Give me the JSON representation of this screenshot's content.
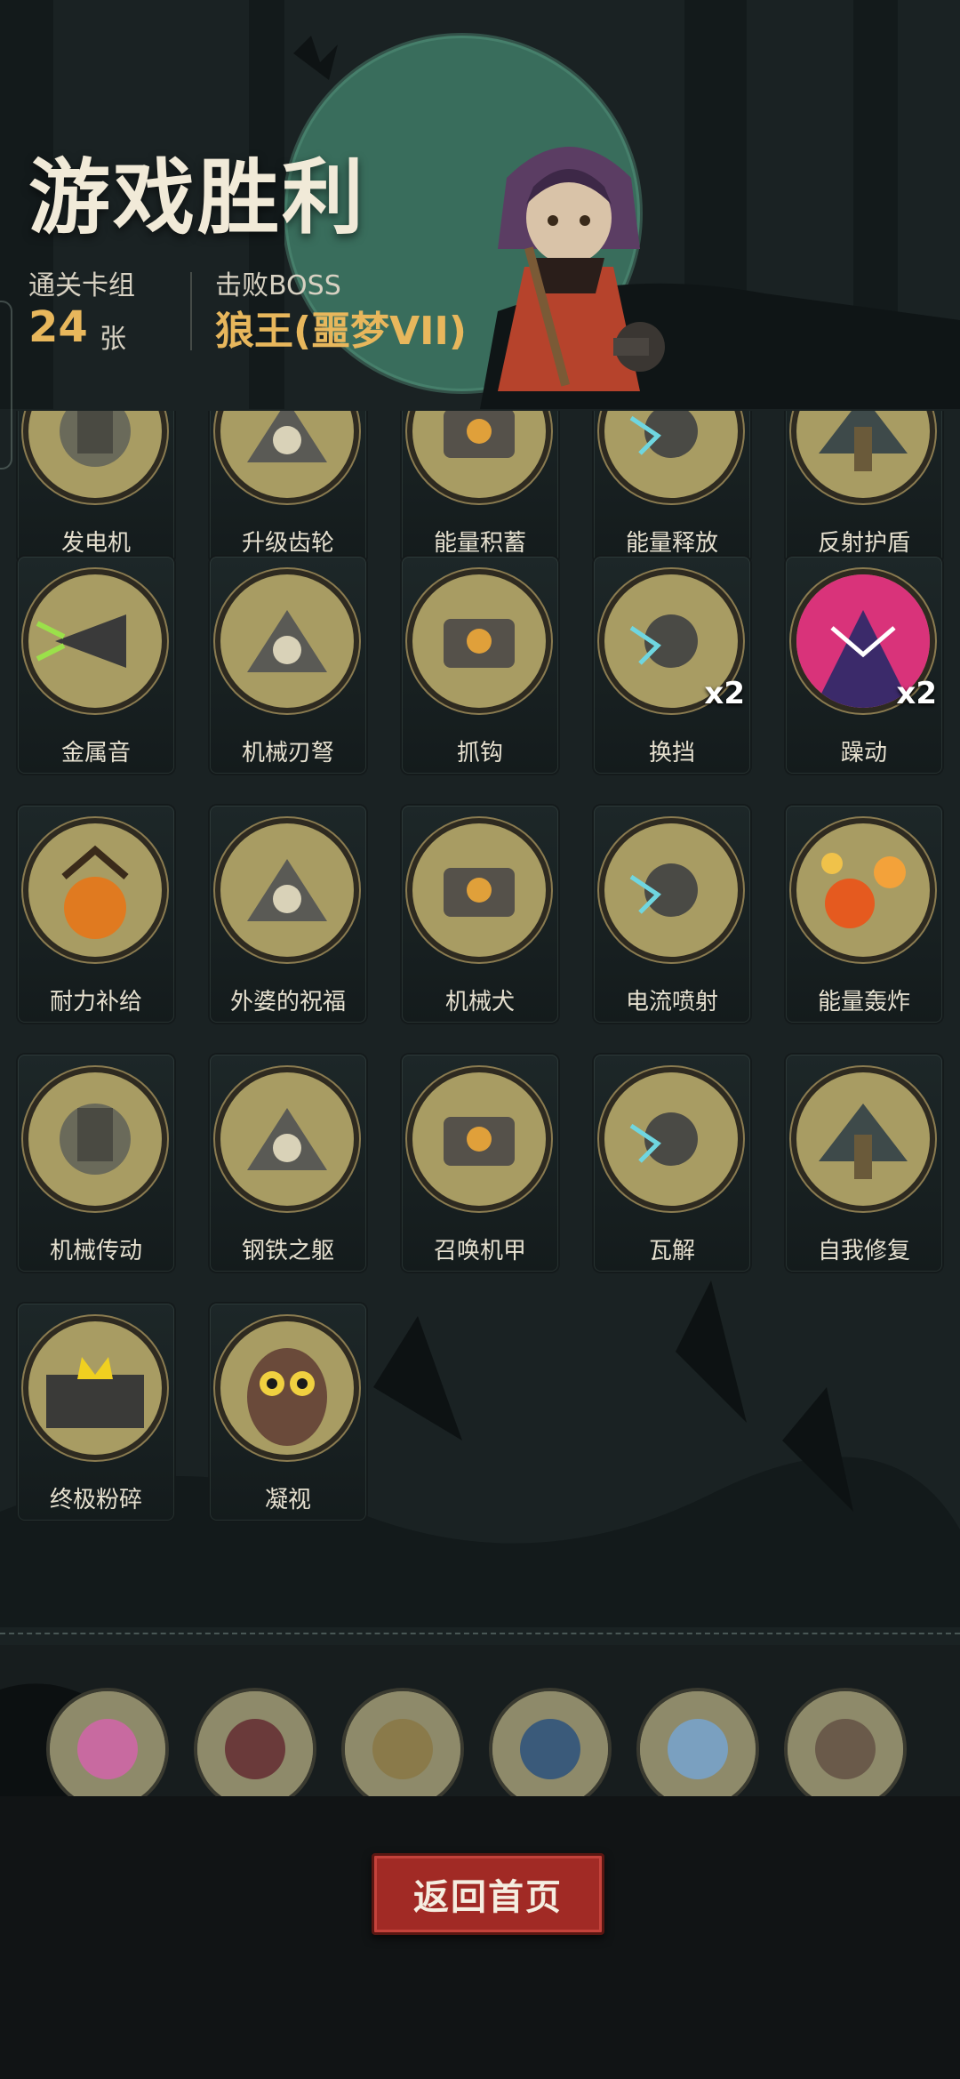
{
  "header": {
    "title": "游戏胜利",
    "deck_label": "通关卡组",
    "deck_count": "24",
    "deck_unit": "张",
    "boss_label": "击败BOSS",
    "boss_name": "狼王(噩梦VII)"
  },
  "cards": [
    {
      "name": "发电机",
      "icon": "generator-icon"
    },
    {
      "name": "升级齿轮",
      "icon": "upgrade-gear-icon"
    },
    {
      "name": "能量积蓄",
      "icon": "energy-charge-icon"
    },
    {
      "name": "能量释放",
      "icon": "energy-release-icon"
    },
    {
      "name": "反射护盾",
      "icon": "reflect-shield-icon"
    },
    {
      "name": "金属音",
      "icon": "metal-horn-icon"
    },
    {
      "name": "机械刃弩",
      "icon": "mech-blade-crossbow-icon"
    },
    {
      "name": "抓钩",
      "icon": "grappling-hook-icon"
    },
    {
      "name": "换挡",
      "icon": "gear-shift-icon",
      "mult": "x2"
    },
    {
      "name": "躁动",
      "icon": "restless-icon",
      "mult": "x2"
    },
    {
      "name": "耐力补给",
      "icon": "stamina-supply-icon"
    },
    {
      "name": "外婆的祝福",
      "icon": "grandma-blessing-icon"
    },
    {
      "name": "机械犬",
      "icon": "mech-dog-icon"
    },
    {
      "name": "电流喷射",
      "icon": "current-jet-icon"
    },
    {
      "name": "能量轰炸",
      "icon": "energy-bombard-icon"
    },
    {
      "name": "机械传动",
      "icon": "mech-transmission-icon"
    },
    {
      "name": "钢铁之躯",
      "icon": "steel-body-icon"
    },
    {
      "name": "召唤机甲",
      "icon": "summon-mech-icon"
    },
    {
      "name": "瓦解",
      "icon": "disintegrate-icon"
    },
    {
      "name": "自我修复",
      "icon": "self-repair-icon"
    },
    {
      "name": "终极粉碎",
      "icon": "ultimate-crush-icon"
    },
    {
      "name": "凝视",
      "icon": "gaze-owl-icon"
    }
  ],
  "relics": [
    {
      "icon": "tentacle-relic-icon"
    },
    {
      "icon": "skull-card-relic-icon"
    },
    {
      "icon": "hourglass-relic-icon"
    },
    {
      "icon": "spellbook-relic-icon"
    },
    {
      "icon": "magnifier-relic-icon"
    },
    {
      "icon": "statue-relic-icon"
    }
  ],
  "footer": {
    "return_label": "返回首页"
  },
  "colors": {
    "accent": "#e8b75c",
    "button_red": "#a12a25",
    "card_art_bg": "#a89c63",
    "moon": "#3f7a66"
  }
}
